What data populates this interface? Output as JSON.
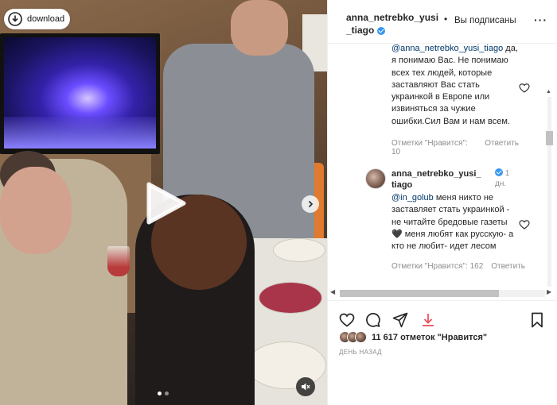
{
  "media": {
    "download_label": "download",
    "carousel_dots": 2,
    "active_dot": 0
  },
  "header": {
    "username": "anna_netrebko_yusi_tiago",
    "separator": "•",
    "follow_status": "Вы подписаны",
    "more": "···"
  },
  "comments": [
    {
      "mention": "@anna_netrebko_yusi_tiago",
      "text": "да, я понимаю Вас. Не понимаю всех тех людей, которые заставляют Вас стать украинкой в Европе или извиняться за чужие ошибки.Сил Вам и нам всем.",
      "likes": "Отметки \"Нравится\": 10",
      "reply": "Ответить"
    },
    {
      "username": "anna_netrebko_yusi_tiago",
      "ago": "1 дн.",
      "mention": "@in_golub",
      "text": " меня никто не заставляет стать украинкой - не читайте бредовые газеты 🖤 меня любят как русскую- а кто не любит- идет лесом",
      "likes": "Отметки \"Нравится\": 162",
      "reply": "Ответить"
    }
  ],
  "likes_summary": "11 617 отметок \"Нравится\"",
  "timestamp": "ДЕНЬ НАЗАД",
  "icons": [
    "download-icon",
    "play-icon",
    "chevron-right-icon",
    "mute-icon",
    "verified-icon",
    "heart-icon",
    "comment-icon",
    "share-icon",
    "save-icon",
    "bookmark-icon"
  ],
  "colors": {
    "accent": "#3897f0",
    "mention": "#00376b",
    "muted": "#8e8e8e",
    "save": "#ed4956"
  }
}
